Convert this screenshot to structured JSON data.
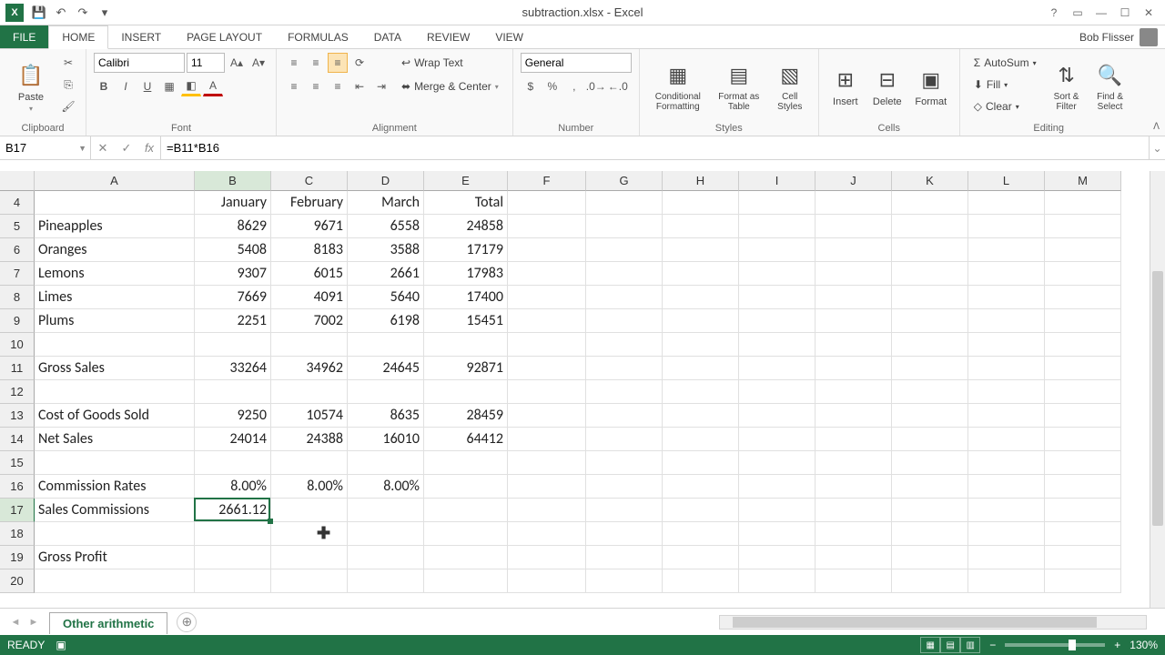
{
  "title": "subtraction.xlsx - Excel",
  "user": "Bob Flisser",
  "qat": {
    "save": "💾",
    "undo": "↶",
    "redo": "↷"
  },
  "tabs": [
    "FILE",
    "HOME",
    "INSERT",
    "PAGE LAYOUT",
    "FORMULAS",
    "DATA",
    "REVIEW",
    "VIEW"
  ],
  "ribbon": {
    "clipboard": {
      "label": "Clipboard",
      "paste": "Paste"
    },
    "font": {
      "label": "Font",
      "name": "Calibri",
      "size": "11"
    },
    "alignment": {
      "label": "Alignment",
      "wrap": "Wrap Text",
      "merge": "Merge & Center"
    },
    "number": {
      "label": "Number",
      "format": "General"
    },
    "styles": {
      "label": "Styles",
      "cond": "Conditional Formatting",
      "table": "Format as Table",
      "cell": "Cell Styles"
    },
    "cells": {
      "label": "Cells",
      "insert": "Insert",
      "delete": "Delete",
      "format": "Format"
    },
    "editing": {
      "label": "Editing",
      "sum": "AutoSum",
      "fill": "Fill",
      "clear": "Clear",
      "sort": "Sort & Filter",
      "find": "Find & Select"
    }
  },
  "name_box": "B17",
  "formula": "=B11*B16",
  "columns": [
    "A",
    "B",
    "C",
    "D",
    "E",
    "F",
    "G",
    "H",
    "I",
    "J",
    "K",
    "L",
    "M"
  ],
  "highlight_col": "B",
  "highlight_row": 17,
  "rows_visible": [
    4,
    5,
    6,
    7,
    8,
    9,
    10,
    11,
    12,
    13,
    14,
    15,
    16,
    17,
    18,
    19,
    20
  ],
  "cells": {
    "4": {
      "B": "January",
      "C": "February",
      "D": "March",
      "E": "Total"
    },
    "5": {
      "A": "Pineapples",
      "B": "8629",
      "C": "9671",
      "D": "6558",
      "E": "24858"
    },
    "6": {
      "A": "Oranges",
      "B": "5408",
      "C": "8183",
      "D": "3588",
      "E": "17179"
    },
    "7": {
      "A": "Lemons",
      "B": "9307",
      "C": "6015",
      "D": "2661",
      "E": "17983"
    },
    "8": {
      "A": "Limes",
      "B": "7669",
      "C": "4091",
      "D": "5640",
      "E": "17400"
    },
    "9": {
      "A": "Plums",
      "B": "2251",
      "C": "7002",
      "D": "6198",
      "E": "15451"
    },
    "10": {},
    "11": {
      "A": "Gross Sales",
      "B": "33264",
      "C": "34962",
      "D": "24645",
      "E": "92871"
    },
    "12": {},
    "13": {
      "A": "Cost of Goods Sold",
      "B": "9250",
      "C": "10574",
      "D": "8635",
      "E": "28459"
    },
    "14": {
      "A": "Net Sales",
      "B": "24014",
      "C": "24388",
      "D": "16010",
      "E": "64412"
    },
    "15": {},
    "16": {
      "A": "Commission Rates",
      "B": "8.00%",
      "C": "8.00%",
      "D": "8.00%"
    },
    "17": {
      "A": "Sales Commissions",
      "B": "2661.12"
    },
    "18": {},
    "19": {
      "A": "Gross Profit"
    },
    "20": {}
  },
  "sheet_tab": "Other arithmetic",
  "status": "READY",
  "zoom": "130%"
}
